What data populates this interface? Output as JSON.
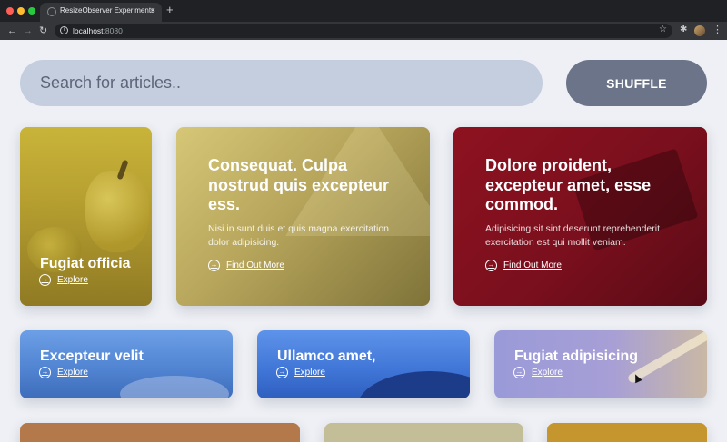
{
  "browser": {
    "tab_title": "ResizeObserver Experiments",
    "tab_close": "×",
    "new_tab": "+",
    "url_host": "localhost",
    "url_port": ":8080",
    "nav_back": "←",
    "nav_forward": "→",
    "nav_reload": "↻",
    "star": "☆",
    "extensions": "✱",
    "menu": "⋮",
    "colors": {
      "tabbar": "#202124",
      "toolbar": "#35363a"
    }
  },
  "search": {
    "placeholder": "Search for articles.."
  },
  "shuffle_label": "SHUFFLE",
  "cards": [
    {
      "title": "Fugiat officia",
      "cta": "Explore"
    },
    {
      "title": "Consequat. Culpa nostrud quis excepteur ess.",
      "description": "Nisi in sunt duis et quis magna exercitation dolor adipisicing.",
      "cta": "Find Out More"
    },
    {
      "title": "Dolore proident, excepteur amet, esse commod.",
      "description": "Adipisicing sit sint deserunt reprehenderit exercitation est qui mollit veniam.",
      "cta": "Find Out More"
    },
    {
      "title": "Excepteur velit",
      "cta": "Explore"
    },
    {
      "title": "Ullamco amet,",
      "cta": "Explore"
    },
    {
      "title": "Fugiat adipisicing",
      "cta": "Explore"
    }
  ],
  "icons": {
    "cta": "arrow-circle-right-icon",
    "search": "none"
  },
  "colors": {
    "page_bg": "#eef0f5",
    "search_bg": "#c4cede",
    "shuffle_bg": "#6b7489"
  }
}
